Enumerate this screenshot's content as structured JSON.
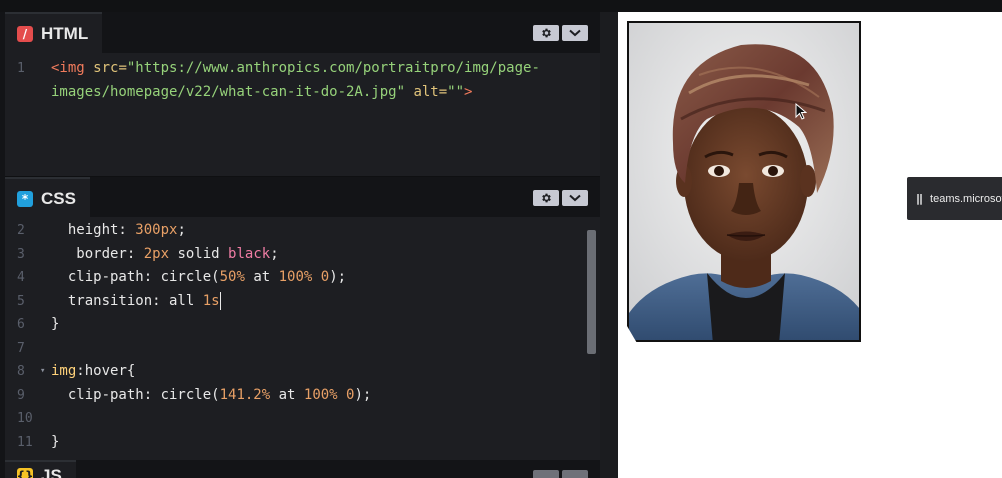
{
  "html_panel": {
    "label": "HTML",
    "icon": "html-slash-icon",
    "lines": [
      {
        "num": "1",
        "tokens": [
          {
            "t": "<img ",
            "c": "tag"
          },
          {
            "t": "src=",
            "c": "attr"
          },
          {
            "t": "\"https://www.anthropics.com/portraitpro/img/page-",
            "c": "str"
          }
        ]
      },
      {
        "num": "",
        "tokens": [
          {
            "t": "images/homepage/v22/what-can-it-do-2A.jpg\"",
            "c": "str"
          },
          {
            "t": " alt=",
            "c": "attr"
          },
          {
            "t": "\"\"",
            "c": "str"
          },
          {
            "t": ">",
            "c": "tag"
          }
        ]
      }
    ]
  },
  "css_panel": {
    "label": "CSS",
    "icon": "css-asterisk-icon",
    "lines": [
      {
        "num": "2",
        "tokens": [
          {
            "t": "  height: ",
            "c": "prop"
          },
          {
            "t": "300px",
            "c": "num"
          },
          {
            "t": ";",
            "c": "punc"
          }
        ]
      },
      {
        "num": "3",
        "tokens": [
          {
            "t": "   border: ",
            "c": "prop"
          },
          {
            "t": "2px",
            "c": "num"
          },
          {
            "t": " solid ",
            "c": "prop"
          },
          {
            "t": "black",
            "c": "kw"
          },
          {
            "t": ";",
            "c": "punc"
          }
        ]
      },
      {
        "num": "4",
        "tokens": [
          {
            "t": "  clip-path: ",
            "c": "prop"
          },
          {
            "t": "circle(",
            "c": "fn"
          },
          {
            "t": "50%",
            "c": "num"
          },
          {
            "t": " at ",
            "c": "prop"
          },
          {
            "t": "100%",
            "c": "num"
          },
          {
            "t": " ",
            "c": "prop"
          },
          {
            "t": "0",
            "c": "num"
          },
          {
            "t": ");",
            "c": "punc"
          }
        ]
      },
      {
        "num": "5",
        "tokens": [
          {
            "t": "  transition: all ",
            "c": "prop"
          },
          {
            "t": "1s",
            "c": "num"
          }
        ],
        "cursor": true
      },
      {
        "num": "6",
        "tokens": [
          {
            "t": "}",
            "c": "punc"
          }
        ]
      },
      {
        "num": "7",
        "tokens": []
      },
      {
        "num": "8",
        "fold": true,
        "tokens": [
          {
            "t": "img",
            "c": "sel"
          },
          {
            "t": ":hover{",
            "c": "pseudo"
          }
        ]
      },
      {
        "num": "9",
        "tokens": [
          {
            "t": "  clip-path: ",
            "c": "prop"
          },
          {
            "t": "circle(",
            "c": "fn"
          },
          {
            "t": "141.2%",
            "c": "num"
          },
          {
            "t": " at ",
            "c": "prop"
          },
          {
            "t": "100%",
            "c": "num"
          },
          {
            "t": " ",
            "c": "prop"
          },
          {
            "t": "0",
            "c": "num"
          },
          {
            "t": ");",
            "c": "punc"
          }
        ]
      },
      {
        "num": "10",
        "tokens": []
      },
      {
        "num": "11",
        "tokens": [
          {
            "t": "}",
            "c": "punc"
          }
        ]
      }
    ]
  },
  "js_panel": {
    "label": "JS",
    "icon": "js-icon"
  },
  "notification": {
    "text": "teams.microsoft."
  },
  "colors": {
    "html_icon": "#e44d4d",
    "css_icon": "#21a0dd",
    "js_icon": "#f7c325"
  }
}
